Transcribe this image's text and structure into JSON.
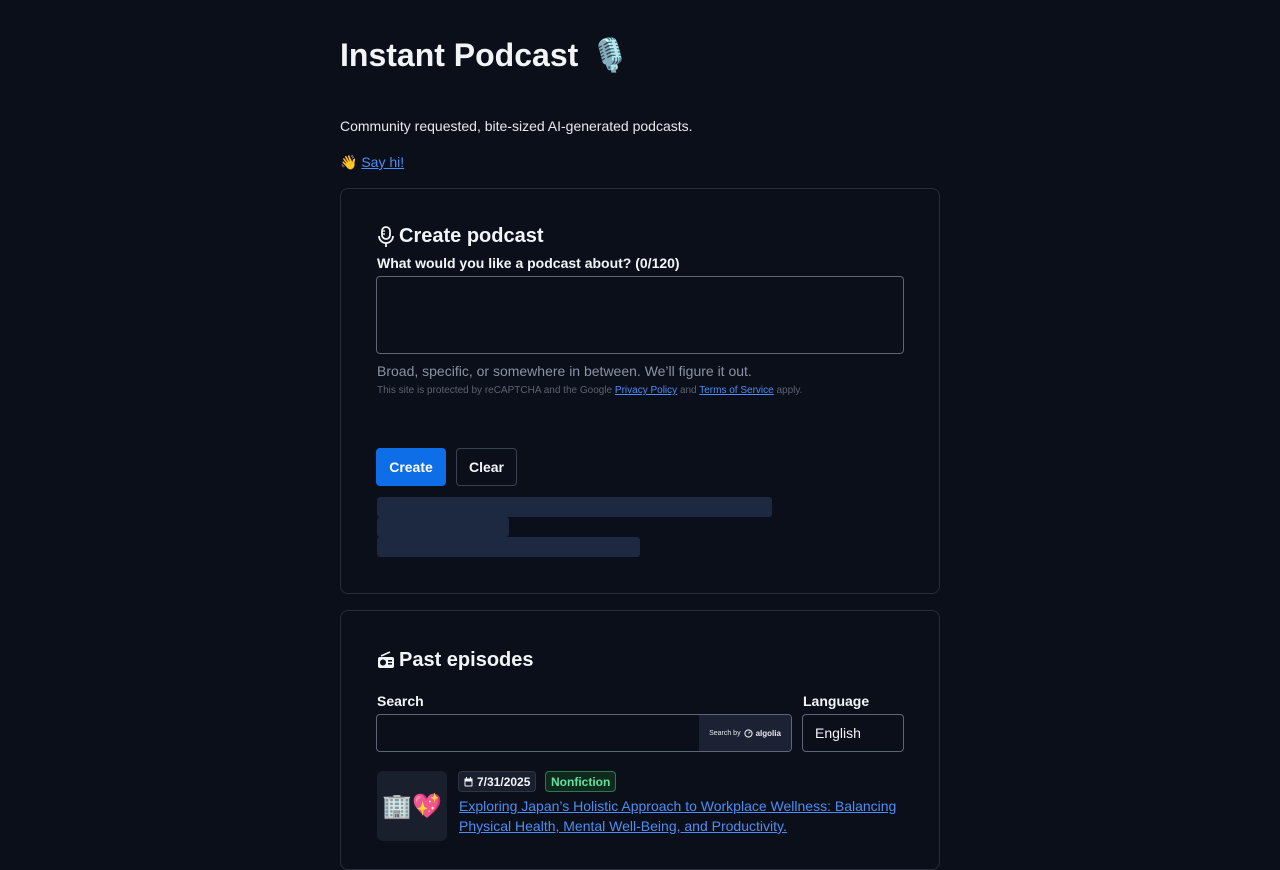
{
  "header": {
    "title": "Instant Podcast",
    "title_emoji": "🎙️",
    "subtitle": "Community requested, bite-sized AI-generated podcasts.",
    "say_hi_emoji": "👋",
    "say_hi_link": "Say hi!"
  },
  "create": {
    "heading": "Create podcast",
    "heading_icon": "microphone-icon",
    "prompt_label": "What would you like a podcast about? (0/120)",
    "prompt_value": "",
    "hint": "Broad, specific, or somewhere in between. We’ll figure it out.",
    "recaptcha": {
      "prefix": "This site is protected by reCAPTCHA and the Google",
      "privacy_link": "Privacy Policy",
      "and": "and",
      "terms_link": "Terms of Service",
      "suffix": "apply."
    },
    "create_button": "Create",
    "clear_button": "Clear"
  },
  "past": {
    "heading": "Past episodes",
    "heading_icon": "radio-icon",
    "search_label": "Search",
    "search_value": "",
    "search_by": "Search by",
    "search_brand": "algolia",
    "language_label": "Language",
    "language_value": "English",
    "episodes": [
      {
        "thumb": "🏢💖",
        "date": "7/31/2025",
        "genre": "Nonfiction",
        "title": "Exploring Japan’s Holistic Approach to Workplace Wellness: Balancing Physical Health, Mental Well-Being, and Productivity."
      }
    ]
  },
  "colors": {
    "background": "#0b0f19",
    "accent": "#0d6ee8",
    "link": "#4c8df6",
    "skeleton": "#1c2940",
    "genre_green": "#5fe3a0"
  }
}
